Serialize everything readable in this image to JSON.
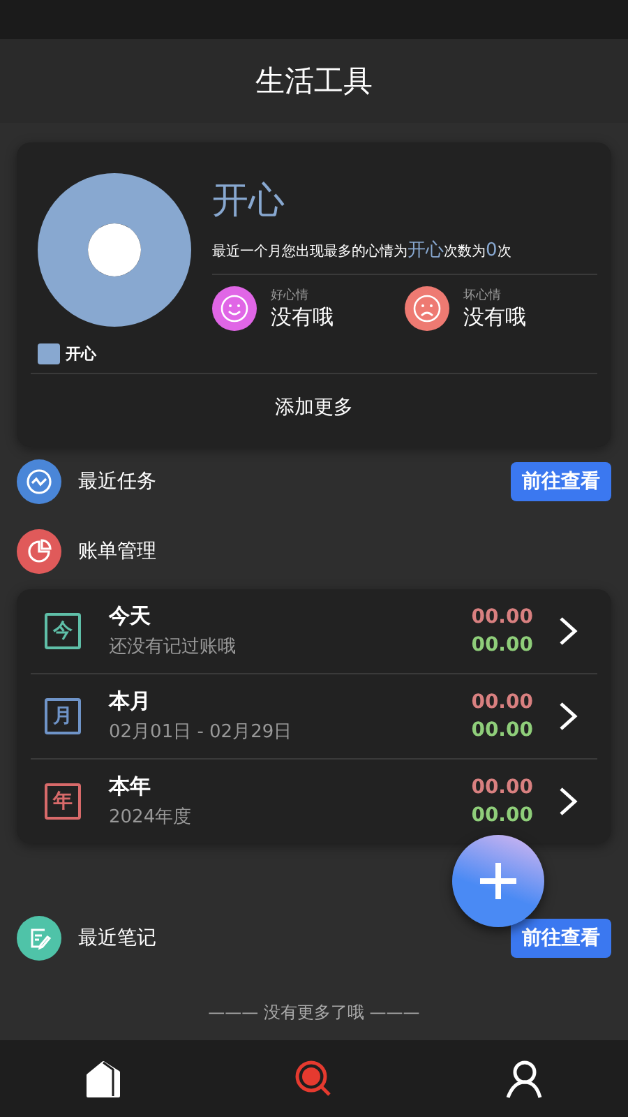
{
  "header": {
    "title": "生活工具"
  },
  "mood": {
    "chart_label": "开心",
    "color": "#88a8d0",
    "title": "开心",
    "summary": [
      {
        "text": "最近一个月您出现最多的心情为",
        "highlight": false
      },
      {
        "text": "开心",
        "highlight": true
      },
      {
        "text": "次数为",
        "highlight": false
      },
      {
        "text": "0",
        "highlight": true
      },
      {
        "text": "次",
        "highlight": false
      }
    ],
    "stats": [
      {
        "kind": "good",
        "label": "好心情",
        "value": "没有哦"
      },
      {
        "kind": "bad",
        "label": "坏心情",
        "value": "没有哦"
      }
    ],
    "add_more": "添加更多"
  },
  "sections": [
    {
      "kind": "tasks",
      "title": "最近任务",
      "button": "前往查看"
    },
    {
      "kind": "bills",
      "title": "账单管理"
    }
  ],
  "bills": [
    {
      "badge": "今",
      "color": "#5fbfa8",
      "title": "今天",
      "subtitle": "还没有记过账哦",
      "expense": "00.00",
      "income": "00.00"
    },
    {
      "badge": "月",
      "color": "#6f94c8",
      "title": "本月",
      "subtitle": "02月01日 - 02月29日",
      "expense": "00.00",
      "income": "00.00"
    },
    {
      "badge": "年",
      "color": "#d86a6a",
      "title": "本年",
      "subtitle": "2024年度",
      "expense": "00.00",
      "income": "00.00"
    }
  ],
  "notes": {
    "kind": "notes",
    "title": "最近笔记",
    "button": "前往查看"
  },
  "footer": "——— 没有更多了哦 ———",
  "nav": [
    {
      "kind": "home",
      "selected": false
    },
    {
      "kind": "search",
      "selected": true
    },
    {
      "kind": "profile",
      "selected": false
    }
  ]
}
